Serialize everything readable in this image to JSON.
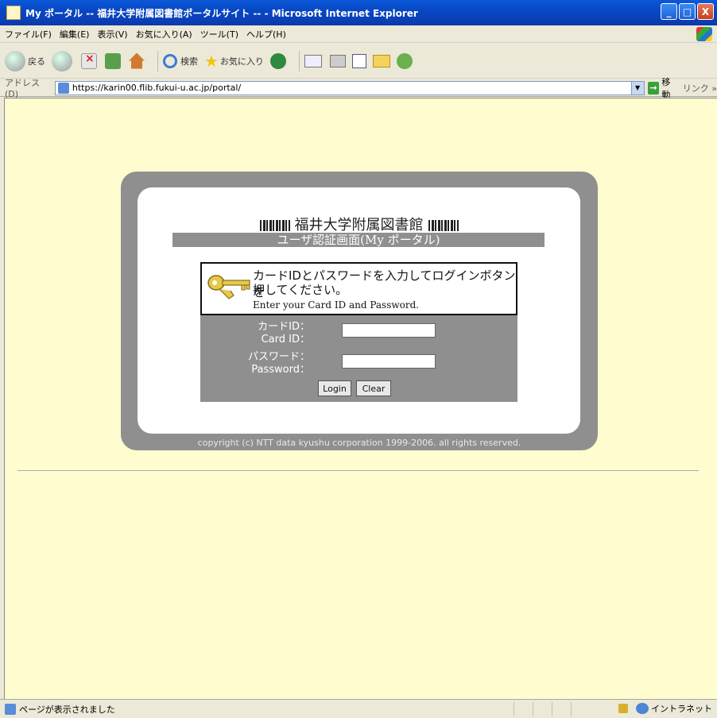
{
  "window": {
    "title": "My ポータル -- 福井大学附属図書館ポータルサイト -- - Microsoft Internet Explorer",
    "buttons": {
      "minimize": "_",
      "maximize": "□",
      "close": "X"
    }
  },
  "menu": {
    "items": [
      {
        "label": "ファイル(F)"
      },
      {
        "label": "編集(E)"
      },
      {
        "label": "表示(V)"
      },
      {
        "label": "お気に入り(A)"
      },
      {
        "label": "ツール(T)"
      },
      {
        "label": "ヘルプ(H)"
      }
    ]
  },
  "toolbar": {
    "back_label": "戻る",
    "search_label": "検索",
    "favorites_label": "お気に入り"
  },
  "address": {
    "label": "アドレス(D)",
    "url": "https://karin00.flib.fukui-u.ac.jp/portal/",
    "go_label": "移動",
    "links_label": "リンク »"
  },
  "page": {
    "library_title": "福井大学附属図書館",
    "subtitle": "ユーザ認証画面(My ポータル)",
    "instruction_jp_line1": "カードIDとパスワードを入力してログインボタンを",
    "instruction_jp_line2": "押してください。",
    "instruction_en": "Enter your Card ID and Password.",
    "card_id_label_jp": "カードID：",
    "card_id_label_en": "Card ID：",
    "password_label_jp": "パスワード：",
    "password_label_en": "Password：",
    "card_id_value": "",
    "password_value": "",
    "login_button": "Login",
    "clear_button": "Clear",
    "copyright": "copyright (c) NTT data kyushu corporation 1999-2006. all rights reserved."
  },
  "status": {
    "text": "ページが表示されました",
    "zone": "イントラネット"
  },
  "colors": {
    "titlebar": "#0a49c5",
    "content_bg": "#fffdd0",
    "card_gray": "#8f8f8f"
  }
}
